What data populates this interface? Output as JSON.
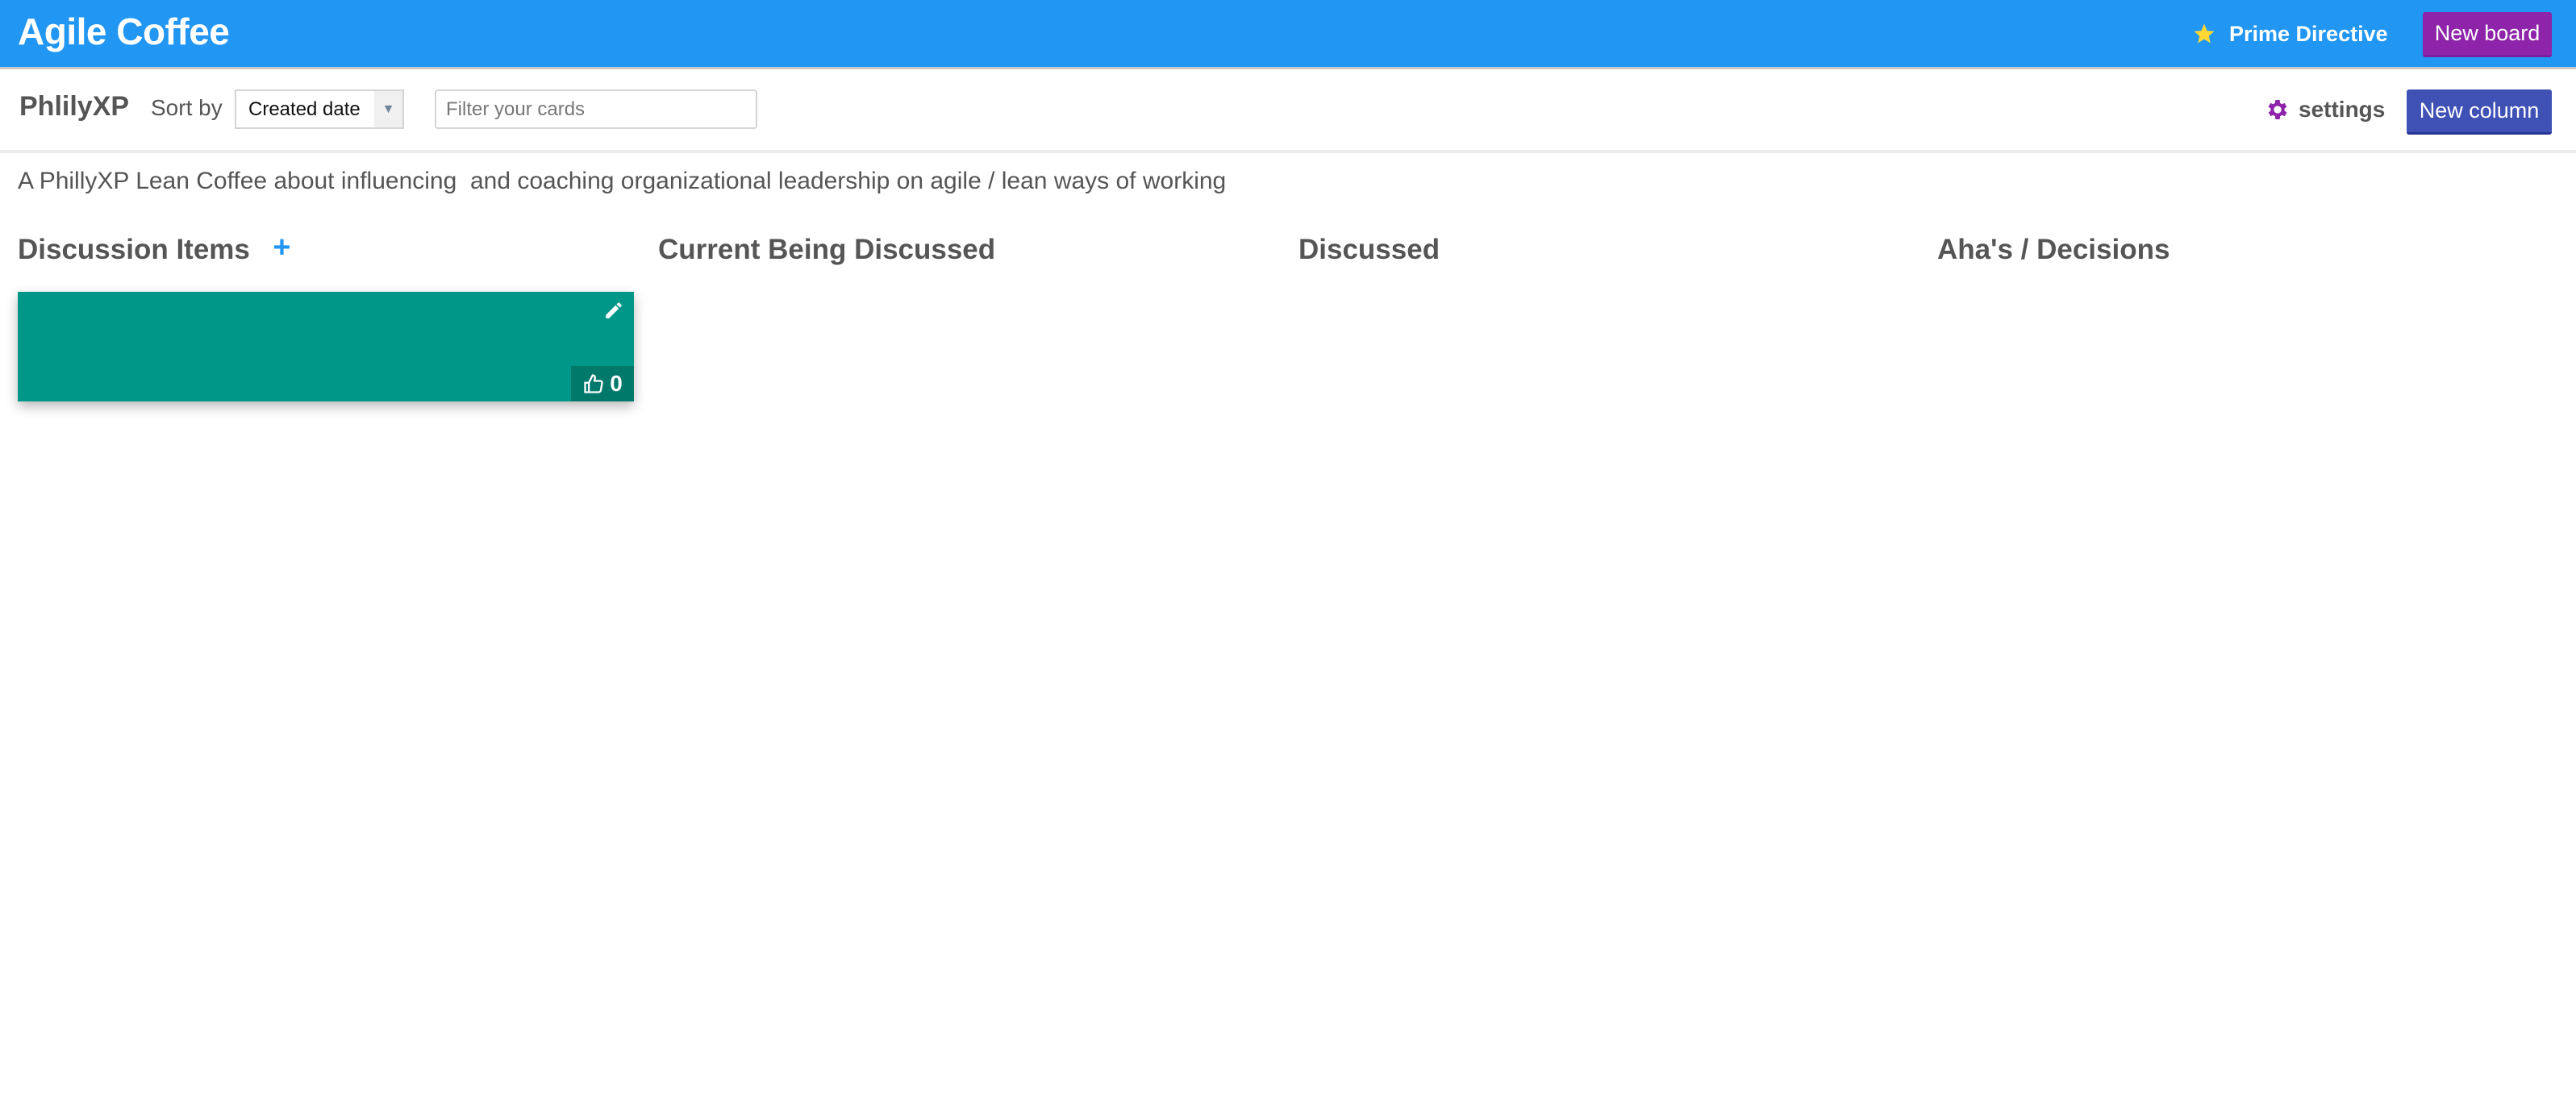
{
  "header": {
    "app_title": "Agile Coffee",
    "prime_directive_label": "Prime Directive",
    "prime_directive_icon": "star-icon",
    "new_board_label": "New board",
    "colors": {
      "bar": "#2196f3",
      "new_board": "#8e24aa",
      "star": "#fdd835"
    }
  },
  "toolbar": {
    "board_name": "PhlilyXP",
    "sort_label": "Sort by",
    "sort_selected": "Created date",
    "filter_placeholder": "Filter your cards",
    "filter_value": "",
    "settings_label": "settings",
    "settings_icon": "gear-icon",
    "new_column_label": "New column",
    "colors": {
      "gear": "#8e24aa",
      "new_column": "#3f51b5"
    }
  },
  "board": {
    "description": "A PhillyXP Lean Coffee about influencing  and coaching organizational leadership on agile / lean ways of working",
    "columns": [
      {
        "title": "Discussion Items",
        "add_icon": "plus-icon",
        "add_symbol": "+",
        "cards": [
          {
            "text": "",
            "votes": "0",
            "color": "#009688"
          }
        ]
      },
      {
        "title": "Current Being Discussed",
        "cards": []
      },
      {
        "title": "Discussed",
        "cards": []
      },
      {
        "title": "Aha's / Decisions",
        "cards": []
      }
    ]
  }
}
